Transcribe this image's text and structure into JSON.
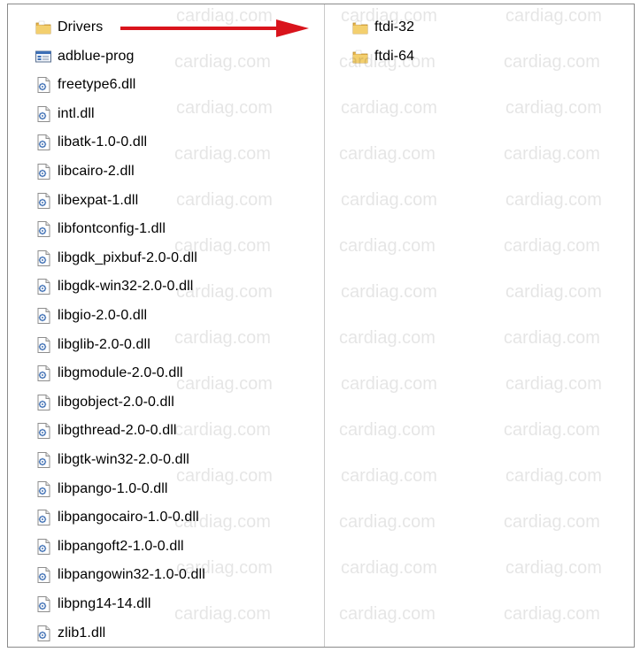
{
  "left_pane": {
    "items": [
      {
        "label": "Drivers",
        "icon": "folder-icon",
        "type": "folder"
      },
      {
        "label": "adblue-prog",
        "icon": "application-icon",
        "type": "application"
      },
      {
        "label": "freetype6.dll",
        "icon": "dll-file-icon",
        "type": "dll"
      },
      {
        "label": "intl.dll",
        "icon": "dll-file-icon",
        "type": "dll"
      },
      {
        "label": "libatk-1.0-0.dll",
        "icon": "dll-file-icon",
        "type": "dll"
      },
      {
        "label": "libcairo-2.dll",
        "icon": "dll-file-icon",
        "type": "dll"
      },
      {
        "label": "libexpat-1.dll",
        "icon": "dll-file-icon",
        "type": "dll"
      },
      {
        "label": "libfontconfig-1.dll",
        "icon": "dll-file-icon",
        "type": "dll"
      },
      {
        "label": "libgdk_pixbuf-2.0-0.dll",
        "icon": "dll-file-icon",
        "type": "dll"
      },
      {
        "label": "libgdk-win32-2.0-0.dll",
        "icon": "dll-file-icon",
        "type": "dll"
      },
      {
        "label": "libgio-2.0-0.dll",
        "icon": "dll-file-icon",
        "type": "dll"
      },
      {
        "label": "libglib-2.0-0.dll",
        "icon": "dll-file-icon",
        "type": "dll"
      },
      {
        "label": "libgmodule-2.0-0.dll",
        "icon": "dll-file-icon",
        "type": "dll"
      },
      {
        "label": "libgobject-2.0-0.dll",
        "icon": "dll-file-icon",
        "type": "dll"
      },
      {
        "label": "libgthread-2.0-0.dll",
        "icon": "dll-file-icon",
        "type": "dll"
      },
      {
        "label": "libgtk-win32-2.0-0.dll",
        "icon": "dll-file-icon",
        "type": "dll"
      },
      {
        "label": "libpango-1.0-0.dll",
        "icon": "dll-file-icon",
        "type": "dll"
      },
      {
        "label": "libpangocairo-1.0-0.dll",
        "icon": "dll-file-icon",
        "type": "dll"
      },
      {
        "label": "libpangoft2-1.0-0.dll",
        "icon": "dll-file-icon",
        "type": "dll"
      },
      {
        "label": "libpangowin32-1.0-0.dll",
        "icon": "dll-file-icon",
        "type": "dll"
      },
      {
        "label": "libpng14-14.dll",
        "icon": "dll-file-icon",
        "type": "dll"
      },
      {
        "label": "zlib1.dll",
        "icon": "dll-file-icon",
        "type": "dll"
      }
    ]
  },
  "right_pane": {
    "items": [
      {
        "label": "ftdi-32",
        "icon": "folder-icon",
        "type": "folder"
      },
      {
        "label": "ftdi-64",
        "icon": "folder-icon",
        "type": "folder"
      }
    ]
  },
  "watermark": {
    "text": "cardiag.com"
  },
  "colors": {
    "arrow": "#d9141c",
    "folder_body": "#e8b64a",
    "folder_tab": "#f3cf6e",
    "dll_blue": "#4a78b8"
  }
}
